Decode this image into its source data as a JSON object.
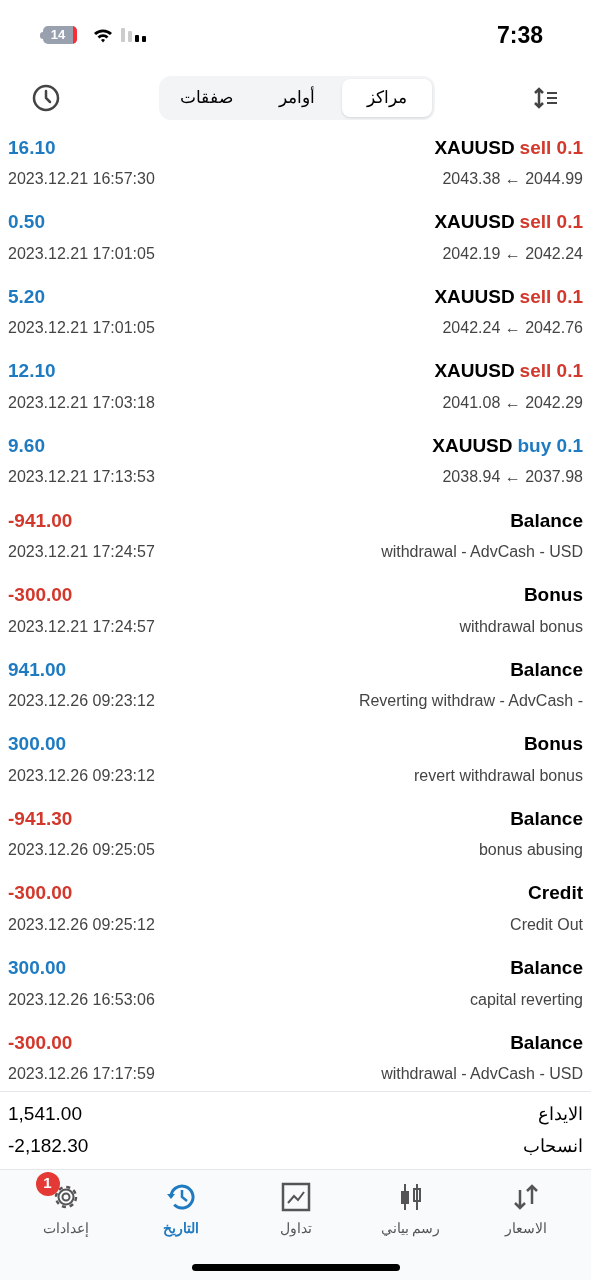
{
  "status_bar": {
    "battery": "14",
    "time": "7:38"
  },
  "segments": [
    {
      "label": "مراكز",
      "selected": true
    },
    {
      "label": "أوامر",
      "selected": false
    },
    {
      "label": "صفقات",
      "selected": false
    }
  ],
  "deals": [
    {
      "kind": "sell",
      "symbol": "XAUUSD",
      "action": "sell 0.1",
      "prices": "2043.38 ← 2044.99",
      "amount": "16.10",
      "profit": true,
      "time": "2023.12.21 16:57:30"
    },
    {
      "kind": "sell",
      "symbol": "XAUUSD",
      "action": "sell 0.1",
      "prices": "2042.19 ← 2042.24",
      "amount": "0.50",
      "profit": true,
      "time": "2023.12.21 17:01:05"
    },
    {
      "kind": "sell",
      "symbol": "XAUUSD",
      "action": "sell 0.1",
      "prices": "2042.24 ← 2042.76",
      "amount": "5.20",
      "profit": true,
      "time": "2023.12.21 17:01:05"
    },
    {
      "kind": "sell",
      "symbol": "XAUUSD",
      "action": "sell 0.1",
      "prices": "2041.08 ← 2042.29",
      "amount": "12.10",
      "profit": true,
      "time": "2023.12.21 17:03:18"
    },
    {
      "kind": "buy",
      "symbol": "XAUUSD",
      "action": "buy 0.1",
      "prices": "2038.94 ← 2037.98",
      "amount": "9.60",
      "profit": true,
      "time": "2023.12.21 17:13:53"
    },
    {
      "kind": "operation",
      "title": "Balance",
      "comment": "withdrawal - AdvCash - USD",
      "amount": "-941.00",
      "profit": false,
      "time": "2023.12.21 17:24:57"
    },
    {
      "kind": "operation",
      "title": "Bonus",
      "comment": "withdrawal bonus",
      "amount": "-300.00",
      "profit": false,
      "time": "2023.12.21 17:24:57"
    },
    {
      "kind": "operation",
      "title": "Balance",
      "comment": "Reverting withdraw - AdvCash -",
      "amount": "941.00",
      "profit": true,
      "time": "2023.12.26 09:23:12"
    },
    {
      "kind": "operation",
      "title": "Bonus",
      "comment": "revert withdrawal bonus",
      "amount": "300.00",
      "profit": true,
      "time": "2023.12.26 09:23:12"
    },
    {
      "kind": "operation",
      "title": "Balance",
      "comment": "bonus abusing",
      "amount": "-941.30",
      "profit": false,
      "time": "2023.12.26 09:25:05"
    },
    {
      "kind": "operation",
      "title": "Credit",
      "comment": "Credit Out",
      "amount": "-300.00",
      "profit": false,
      "time": "2023.12.26 09:25:12"
    },
    {
      "kind": "operation",
      "title": "Balance",
      "comment": "capital reverting",
      "amount": "300.00",
      "profit": true,
      "time": "2023.12.26 16:53:06"
    },
    {
      "kind": "operation",
      "title": "Balance",
      "comment": "withdrawal - AdvCash - USD",
      "amount": "-300.00",
      "profit": false,
      "time": "2023.12.26 17:17:59"
    }
  ],
  "summary": [
    {
      "label": "الايداع",
      "value": "1,541.00"
    },
    {
      "label": "انسحاب",
      "value": "-2,182.30"
    }
  ],
  "tab_bar": [
    {
      "kind": "quotes",
      "label": "الاسعار",
      "selected": false
    },
    {
      "kind": "chart",
      "label": "رسم بياني",
      "selected": false
    },
    {
      "kind": "trade",
      "label": "تداول",
      "selected": false
    },
    {
      "kind": "history",
      "label": "التاريخ",
      "selected": true
    },
    {
      "kind": "settings",
      "label": "إعدادات",
      "selected": false,
      "badge": "1"
    }
  ]
}
